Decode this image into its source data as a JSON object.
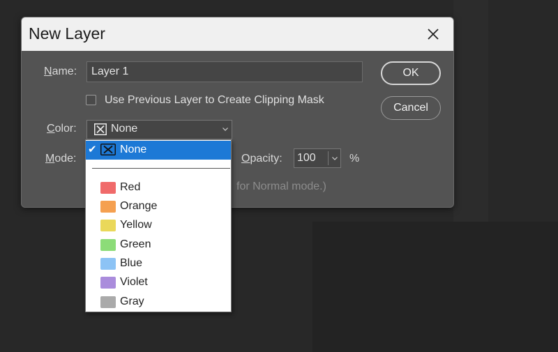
{
  "dialog": {
    "title": "New Layer",
    "name_label_u": "N",
    "name_label_rest": "ame:",
    "name_value": "Layer 1",
    "checkbox_label": "Use Previous Layer to Create Clipping Mask",
    "checkbox_checked": false,
    "color_label_u": "C",
    "color_label_rest": "olor:",
    "color_value": "None",
    "mode_label_u": "M",
    "mode_label_rest": "ode:",
    "opacity_label_u": "O",
    "opacity_label_rest": "pacity:",
    "opacity_value": "100",
    "opacity_unit": "%",
    "hint_fragment": "for Normal mode.)",
    "ok_label": "OK",
    "cancel_label": "Cancel"
  },
  "dropdown": {
    "selected": "None",
    "items": [
      {
        "label": "None",
        "swatch": "x-icon",
        "color": "none"
      },
      {
        "label": "Red",
        "color": "#f06a6a"
      },
      {
        "label": "Orange",
        "color": "#f5a050"
      },
      {
        "label": "Yellow",
        "color": "#ead85a"
      },
      {
        "label": "Green",
        "color": "#8cdc78"
      },
      {
        "label": "Blue",
        "color": "#8cc3f5"
      },
      {
        "label": "Violet",
        "color": "#aa8cdc"
      },
      {
        "label": "Gray",
        "color": "#aaaaaa"
      }
    ]
  },
  "colors": {
    "accent": "#1d79d6",
    "dialog_bg": "#535353",
    "titlebar_bg": "#f0f0f0"
  }
}
